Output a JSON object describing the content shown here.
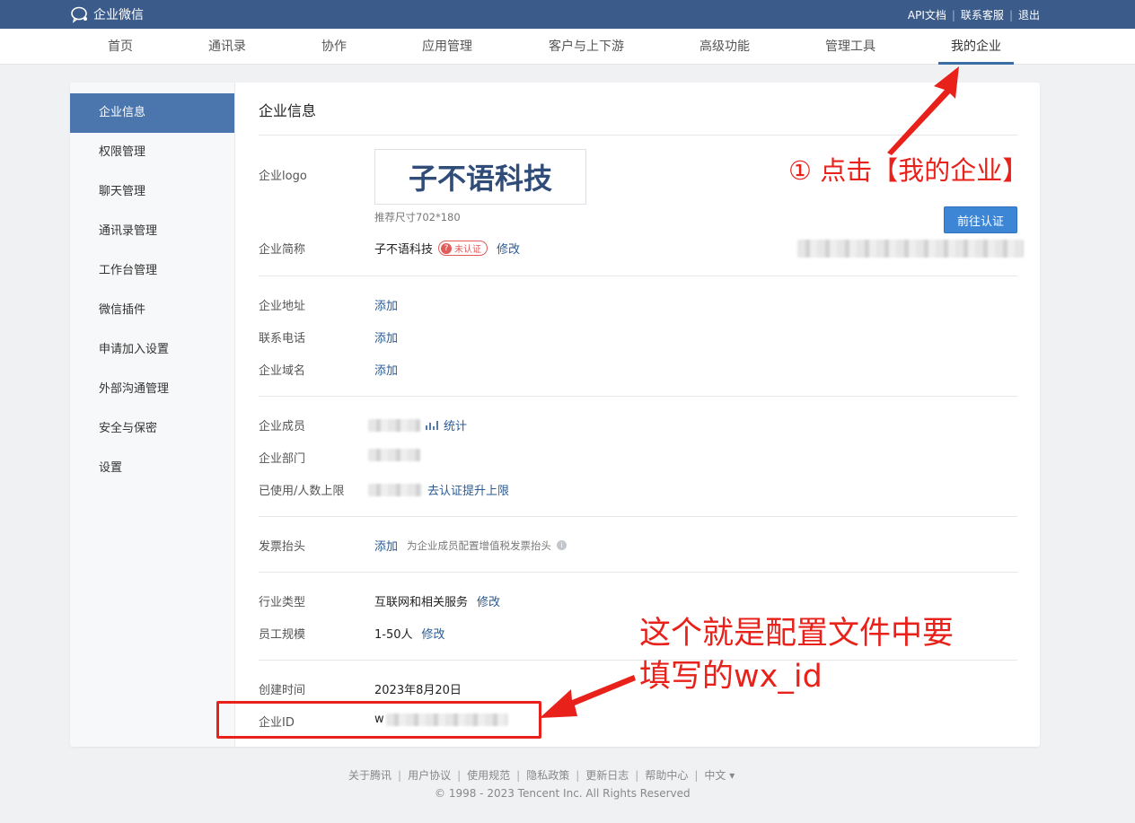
{
  "header": {
    "brand": "企业微信",
    "links": [
      "API文档",
      "联系客服",
      "退出"
    ]
  },
  "nav": {
    "items": [
      "首页",
      "通讯录",
      "协作",
      "应用管理",
      "客户与上下游",
      "高级功能",
      "管理工具",
      "我的企业"
    ],
    "active_index": 7
  },
  "sidebar": {
    "items": [
      "企业信息",
      "权限管理",
      "聊天管理",
      "通讯录管理",
      "工作台管理",
      "微信插件",
      "申请加入设置",
      "外部沟通管理",
      "安全与保密",
      "设置"
    ],
    "active_index": 0
  },
  "main": {
    "title": "企业信息",
    "logo_label": "企业logo",
    "logo_text": "子不语科技",
    "logo_hint": "推荐尺寸702*180",
    "cert_button": "前往认证",
    "short_name_label": "企业简称",
    "short_name": "子不语科技",
    "unverified_badge": "未认证",
    "edit": "修改",
    "address_label": "企业地址",
    "phone_label": "联系电话",
    "domain_label": "企业域名",
    "add": "添加",
    "members_label": "企业成员",
    "stats_link": "统计",
    "departments_label": "企业部门",
    "usage_label": "已使用/人数上限",
    "upgrade_link": "去认证提升上限",
    "invoice_label": "发票抬头",
    "invoice_hint": "为企业成员配置增值税发票抬头",
    "industry_label": "行业类型",
    "industry": "互联网和相关服务",
    "scale_label": "员工规模",
    "scale": "1-50人",
    "created_label": "创建时间",
    "created": "2023年8月20日",
    "corp_id_label": "企业ID",
    "corp_id_prefix": "w"
  },
  "footer": {
    "links": [
      "关于腾讯",
      "用户协议",
      "使用规范",
      "隐私政策",
      "更新日志",
      "帮助中心",
      "中文 ▾"
    ],
    "copyright": "© 1998 - 2023 Tencent Inc. All Rights Reserved"
  },
  "annotations": {
    "step1": "① 点击【我的企业】",
    "note_line1": "这个就是配置文件中要",
    "note_line2": "填写的wx_id",
    "color": "#e8211b"
  }
}
